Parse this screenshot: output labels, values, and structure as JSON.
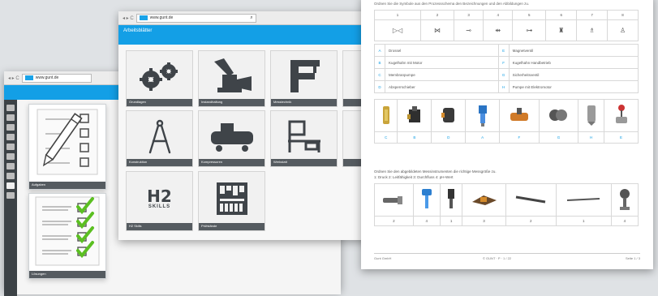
{
  "window_left": {
    "nav": "◂ ▸ C",
    "url": "www.gunt.de",
    "cards": [
      {
        "label": "Aufgaben"
      },
      {
        "label": "Lösungen"
      }
    ]
  },
  "window_middle": {
    "nav": "◂ ▸ C",
    "url": "www.gunt.de",
    "banner": "Arbeitsblätter",
    "tiles": [
      {
        "label": "Grundlagen",
        "icon": "gears-icon"
      },
      {
        "label": "Instandhaltung",
        "icon": "valve-icon"
      },
      {
        "label": "Messtechnik",
        "icon": "caliper-icon"
      },
      {
        "label": "Konstruktion",
        "icon": "compass-icon"
      },
      {
        "label": "Kompressoren",
        "icon": "compressor-icon"
      },
      {
        "label": "Werkstatt",
        "icon": "workbench-icon"
      },
      {
        "label": "H2 Skills",
        "icon": "h2-skills-icon"
      },
      {
        "label": "Prüfstände",
        "icon": "panel-icon"
      }
    ],
    "h2_text": "H2",
    "skills_text": "SKILLS"
  },
  "window_right": {
    "header": "Ordnen Sie die Symbole aus den Prozessschema den Bezeichnungen und den Abbildungen zu.",
    "numbers": [
      "1",
      "2",
      "3",
      "4",
      "5",
      "6",
      "7",
      "8"
    ],
    "legend": [
      [
        "A",
        "Drossel",
        "E",
        "Magnetventil"
      ],
      [
        "B",
        "Kugelhahn mit Motor",
        "F",
        "Kugelhahn Handbetrieb"
      ],
      [
        "C",
        "Membranpumpe",
        "G",
        "Sicherheitsventil"
      ],
      [
        "D",
        "Absperrschieber",
        "H",
        "Pumpe mit Elektromotor"
      ]
    ],
    "answer_row": [
      "C",
      "B",
      "D",
      "A",
      "F",
      "G",
      "H",
      "E"
    ],
    "section2_title": "Ordnen Sie den abgebildeten Messinstrumenten die richtige Messgröße zu.",
    "section2_sub": "1: Druck  2: Leitfähigkeit  3: Durchfluss  4: pH-Wert",
    "section2_answers": [
      "2",
      "4",
      "1",
      "3",
      "2",
      "1",
      "4"
    ],
    "footer_left": "Gunt GmbH",
    "footer_center": "© GUNT · P · 1 / 22",
    "footer_right": "Seite 1 / 3"
  },
  "colors": {
    "accent": "#139fe6",
    "caption_bg": "#555b60",
    "check": "#5bbf21"
  }
}
